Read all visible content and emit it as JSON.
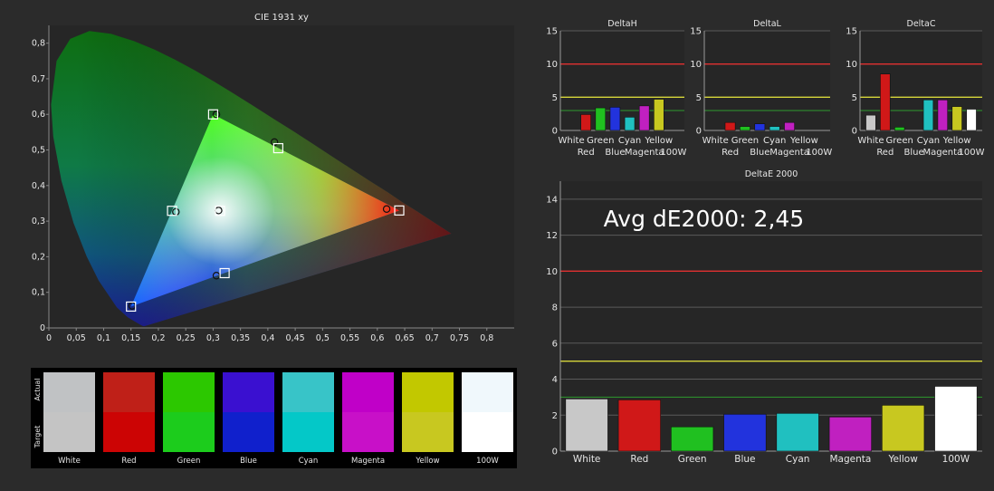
{
  "colors": {
    "background": "#2b2b2b",
    "plot_bg": "#262626",
    "grid": "#5a5a5a",
    "text": "#e6e6e6",
    "red_line": "#e03030",
    "yellow_line": "#d6d63a",
    "green_line": "#2e9a2e"
  },
  "chart_data": [
    {
      "id": "cie",
      "type": "scatter",
      "title": "CIE 1931 xy",
      "xlim": [
        0,
        0.85
      ],
      "ylim": [
        0,
        0.85
      ],
      "x_ticks": [
        "0",
        "0,05",
        "0,1",
        "0,15",
        "0,2",
        "0,25",
        "0,3",
        "0,35",
        "0,4",
        "0,45",
        "0,5",
        "0,55",
        "0,6",
        "0,65",
        "0,7",
        "0,75",
        "0,8"
      ],
      "y_ticks": [
        "0",
        "0,1",
        "0,2",
        "0,3",
        "0,4",
        "0,5",
        "0,6",
        "0,7",
        "0,8"
      ],
      "targets": [
        {
          "name": "Red",
          "x": 0.64,
          "y": 0.33,
          "color": "#cc1010"
        },
        {
          "name": "Green",
          "x": 0.3,
          "y": 0.6,
          "color": "#22cc22"
        },
        {
          "name": "Blue",
          "x": 0.15,
          "y": 0.06,
          "color": "#2233ee"
        },
        {
          "name": "Cyan",
          "x": 0.225,
          "y": 0.329,
          "color": "#22cccc"
        },
        {
          "name": "Magenta",
          "x": 0.321,
          "y": 0.154,
          "color": "#cc22cc"
        },
        {
          "name": "Yellow",
          "x": 0.419,
          "y": 0.505,
          "color": "#cccc22"
        },
        {
          "name": "White",
          "x": 0.3127,
          "y": 0.329,
          "color": "#dddddd"
        }
      ],
      "actuals": [
        {
          "name": "Red",
          "x": 0.617,
          "y": 0.334
        },
        {
          "name": "Green",
          "x": 0.306,
          "y": 0.6
        },
        {
          "name": "Blue",
          "x": 0.152,
          "y": 0.062
        },
        {
          "name": "Cyan",
          "x": 0.232,
          "y": 0.326
        },
        {
          "name": "Magenta",
          "x": 0.306,
          "y": 0.147
        },
        {
          "name": "Yellow",
          "x": 0.412,
          "y": 0.522
        },
        {
          "name": "White",
          "x": 0.31,
          "y": 0.33
        }
      ]
    },
    {
      "id": "deltaH",
      "type": "bar",
      "title": "DeltaH",
      "categories": [
        "White",
        "Red",
        "Green",
        "Blue",
        "Cyan",
        "Magenta",
        "Yellow",
        "100W"
      ],
      "values": [
        0,
        2.4,
        3.4,
        3.5,
        2.0,
        3.7,
        4.7,
        0
      ],
      "colors": [
        "#c8c8c8",
        "#d01818",
        "#20c020",
        "#2233dd",
        "#20c0c0",
        "#c020c0",
        "#c8c820",
        "#ffffff"
      ],
      "ylim": [
        0,
        15
      ],
      "y_ticks": [
        "0",
        "5",
        "10",
        "15"
      ],
      "ref_lines": [
        10,
        5,
        3
      ]
    },
    {
      "id": "deltaL",
      "type": "bar",
      "title": "DeltaL",
      "categories": [
        "White",
        "Red",
        "Green",
        "Blue",
        "Cyan",
        "Magenta",
        "Yellow",
        "100W"
      ],
      "values": [
        0,
        1.2,
        0.6,
        1.0,
        0.6,
        1.2,
        0,
        0
      ],
      "colors": [
        "#c8c8c8",
        "#d01818",
        "#20c020",
        "#2233dd",
        "#20c0c0",
        "#c020c0",
        "#c8c820",
        "#ffffff"
      ],
      "ylim": [
        0,
        15
      ],
      "y_ticks": [
        "0",
        "5",
        "10",
        "15"
      ],
      "ref_lines": [
        10,
        5,
        3
      ]
    },
    {
      "id": "deltaC",
      "type": "bar",
      "title": "DeltaC",
      "categories": [
        "White",
        "Red",
        "Green",
        "Blue",
        "Cyan",
        "Magenta",
        "Yellow",
        "100W"
      ],
      "values": [
        2.3,
        8.5,
        0.5,
        0,
        4.6,
        4.6,
        3.6,
        3.2
      ],
      "colors": [
        "#c8c8c8",
        "#d01818",
        "#20c020",
        "#2233dd",
        "#20c0c0",
        "#c020c0",
        "#c8c820",
        "#ffffff"
      ],
      "ylim": [
        0,
        15
      ],
      "y_ticks": [
        "0",
        "5",
        "10",
        "15"
      ],
      "ref_lines": [
        10,
        5,
        3
      ]
    },
    {
      "id": "deltaE",
      "type": "bar",
      "title": "DeltaE 2000",
      "annotation": "Avg dE2000: 2,45",
      "categories": [
        "White",
        "Red",
        "Green",
        "Blue",
        "Cyan",
        "Magenta",
        "Yellow",
        "100W"
      ],
      "values": [
        2.9,
        2.85,
        1.35,
        2.05,
        2.1,
        1.9,
        2.55,
        3.6
      ],
      "colors": [
        "#c8c8c8",
        "#d01818",
        "#20c020",
        "#2233dd",
        "#20c0c0",
        "#c020c0",
        "#c8c820",
        "#ffffff"
      ],
      "ylim": [
        0,
        15
      ],
      "y_ticks": [
        "0",
        "2",
        "4",
        "6",
        "8",
        "10",
        "12",
        "14"
      ],
      "ref_lines": [
        10,
        5,
        3
      ]
    }
  ],
  "swatches": {
    "actual_label": "Actual",
    "target_label": "Target",
    "items": [
      {
        "name": "White",
        "actual": "#c0c2c4",
        "target": "#c4c4c4"
      },
      {
        "name": "Red",
        "actual": "#bf2018",
        "target": "#cc0404"
      },
      {
        "name": "Green",
        "actual": "#2cc800",
        "target": "#1ccc1c"
      },
      {
        "name": "Blue",
        "actual": "#3a10d0",
        "target": "#1020cc"
      },
      {
        "name": "Cyan",
        "actual": "#38c4c8",
        "target": "#04c8c8"
      },
      {
        "name": "Magenta",
        "actual": "#c000c8",
        "target": "#c810c8"
      },
      {
        "name": "Yellow",
        "actual": "#c2c800",
        "target": "#c8c820"
      },
      {
        "name": "100W",
        "actual": "#f0f8fc",
        "target": "#ffffff"
      }
    ]
  }
}
